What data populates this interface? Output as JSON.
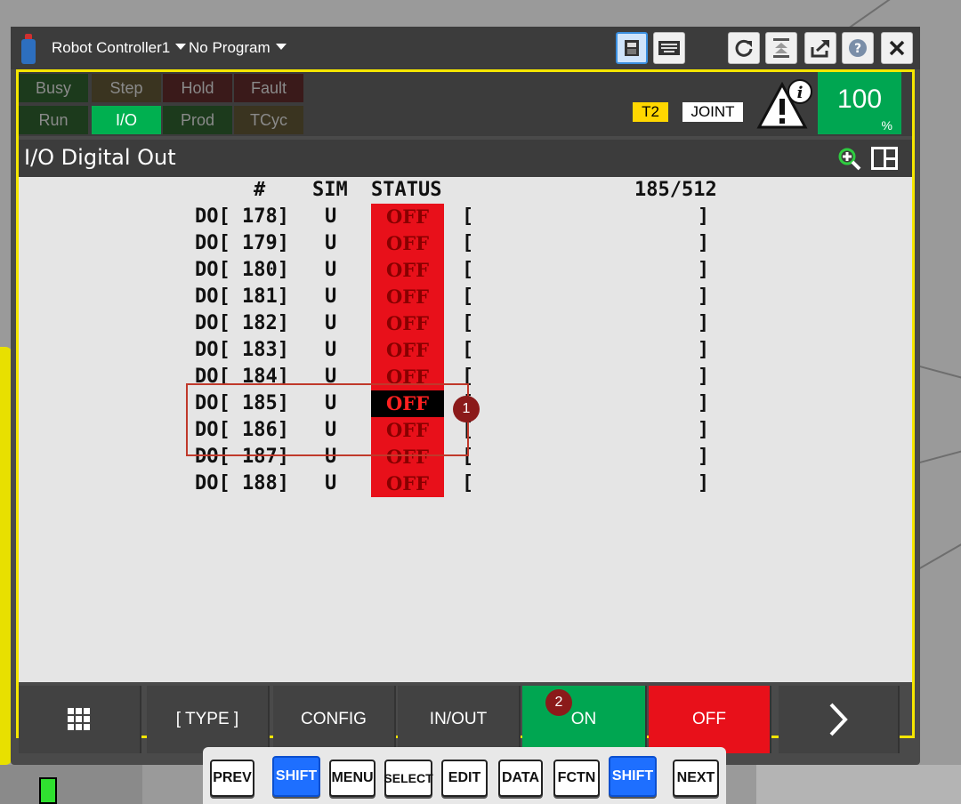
{
  "window": {
    "controller_label": "Robot Controller1",
    "program_label": "No Program"
  },
  "leds": {
    "busy": "Busy",
    "step": "Step",
    "hold": "Hold",
    "fault": "Fault",
    "run": "Run",
    "io": "I/O",
    "prod": "Prod",
    "tcyc": "TCyc"
  },
  "mode": {
    "t2": "T2",
    "joint": "JOINT"
  },
  "override": {
    "value": "100",
    "unit": "%"
  },
  "screen": {
    "title": "I/O Digital Out"
  },
  "table": {
    "col_num": "#",
    "col_sim": "SIM",
    "col_status": "STATUS",
    "position": "185/512",
    "rows": [
      {
        "name": "DO[ 178]",
        "sim": "U",
        "status": "OFF",
        "comment": "[                   ]"
      },
      {
        "name": "DO[ 179]",
        "sim": "U",
        "status": "OFF",
        "comment": "[                   ]"
      },
      {
        "name": "DO[ 180]",
        "sim": "U",
        "status": "OFF",
        "comment": "[                   ]"
      },
      {
        "name": "DO[ 181]",
        "sim": "U",
        "status": "OFF",
        "comment": "[                   ]"
      },
      {
        "name": "DO[ 182]",
        "sim": "U",
        "status": "OFF",
        "comment": "[                   ]"
      },
      {
        "name": "DO[ 183]",
        "sim": "U",
        "status": "OFF",
        "comment": "[                   ]"
      },
      {
        "name": "DO[ 184]",
        "sim": "U",
        "status": "OFF",
        "comment": "[                   ]"
      },
      {
        "name": "DO[ 185]",
        "sim": "U",
        "status": "OFF",
        "comment": "[                   ]"
      },
      {
        "name": "DO[ 186]",
        "sim": "U",
        "status": "OFF",
        "comment": "[                   ]"
      },
      {
        "name": "DO[ 187]",
        "sim": "U",
        "status": "OFF",
        "comment": "[                   ]"
      },
      {
        "name": "DO[ 188]",
        "sim": "U",
        "status": "OFF",
        "comment": "[                   ]"
      }
    ]
  },
  "markers": {
    "m1": "1",
    "m2": "2"
  },
  "fkeys": {
    "type": "[ TYPE ]",
    "config": "CONFIG",
    "inout": "IN/OUT",
    "on": "ON",
    "off": "OFF"
  },
  "keys": {
    "prev": "PREV",
    "shift": "SHIFT",
    "menu": "MENU",
    "select": "SELECT",
    "edit": "EDIT",
    "data": "DATA",
    "fctn": "FCTN",
    "next": "NEXT"
  },
  "colors": {
    "on": "#00a651",
    "off": "#e8101a",
    "frame": "#f5e600"
  },
  "icons": [
    "teach-pendant-icon",
    "caret-down-icon",
    "teach-pendant-view-icon",
    "keyboard-icon",
    "refresh-icon",
    "jog-icon",
    "export-icon",
    "help-icon",
    "close-icon",
    "warning-info-icon",
    "zoom-in-icon",
    "split-view-icon",
    "grid-menu-icon",
    "chevron-right-icon"
  ]
}
